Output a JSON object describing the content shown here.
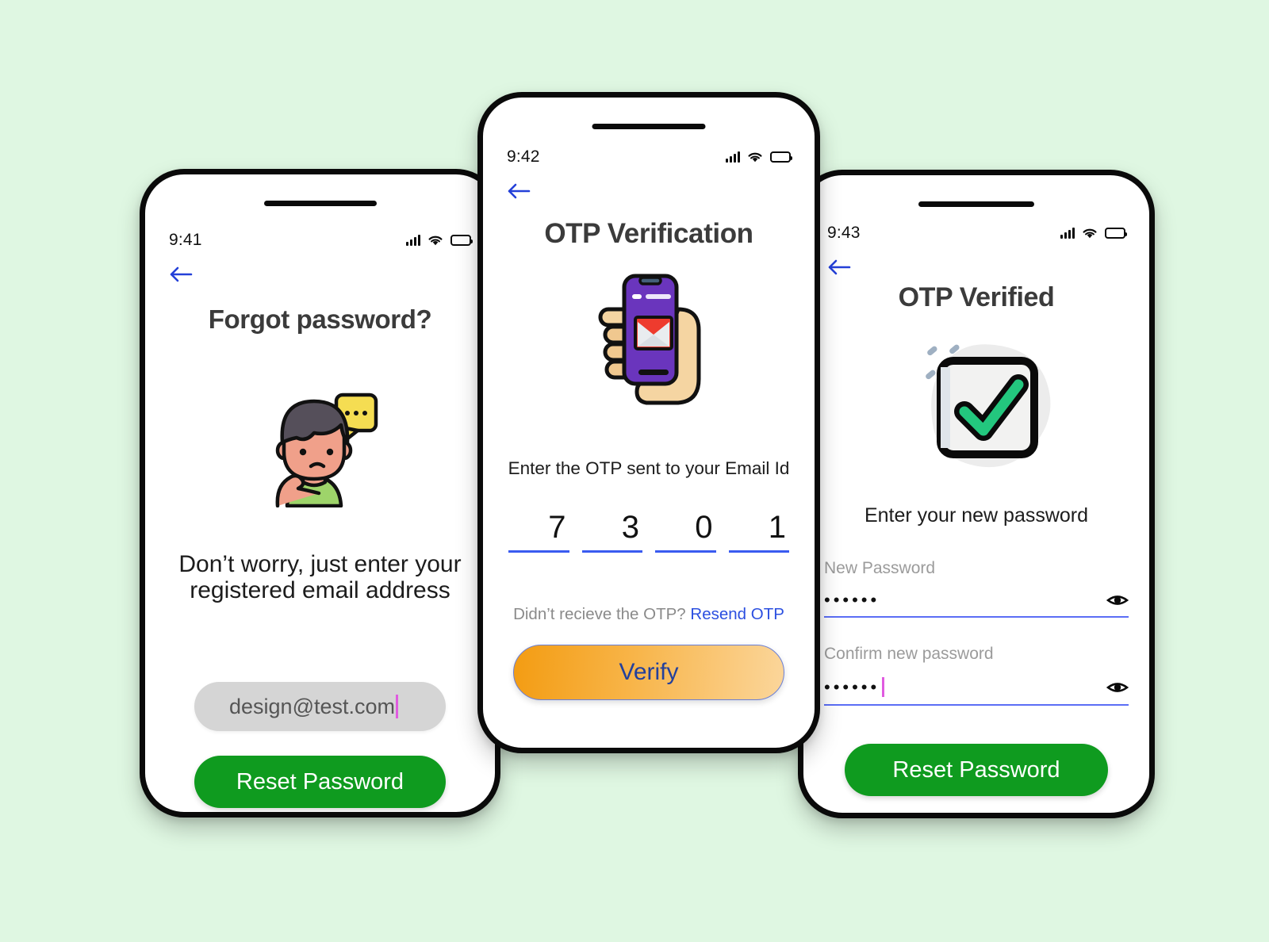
{
  "background_color": "#dff7e2",
  "accent_colors": {
    "primary_green": "#0f9b1f",
    "link_blue": "#2b4fe0",
    "underline_blue": "#3a5bf0",
    "verify_orange": "#f39c12",
    "caret_magenta": "#e05be0",
    "heading_gray": "#3b3b3b"
  },
  "screens": [
    {
      "id": "forgot-password",
      "status": {
        "time": "9:41",
        "signal_icon": "signal-bars-icon",
        "wifi_icon": "wifi-icon",
        "battery_icon": "battery-full-icon"
      },
      "back_icon": "back-arrow-icon",
      "title": "Forgot password?",
      "illustration": "thinking-person-illustration",
      "subtitle": "Don’t worry, just enter your registered email address",
      "email_input": {
        "value": "design@test.com",
        "placeholder": "design@test.com"
      },
      "primary_button": "Reset Password"
    },
    {
      "id": "otp-verification",
      "status": {
        "time": "9:42",
        "signal_icon": "signal-bars-icon",
        "wifi_icon": "wifi-icon",
        "battery_icon": "battery-full-icon"
      },
      "back_icon": "back-arrow-icon",
      "title": "OTP Verification",
      "illustration": "hand-holding-phone-gmail-illustration",
      "subtitle": "Enter the OTP sent to your Email Id",
      "otp_digits": [
        "7",
        "3",
        "0",
        "1"
      ],
      "resend_prompt": "Didn’t recieve the OTP?",
      "resend_link": "Resend OTP",
      "primary_button": "Verify"
    },
    {
      "id": "otp-verified",
      "status": {
        "time": "9:43",
        "signal_icon": "signal-bars-icon",
        "wifi_icon": "wifi-icon",
        "battery_icon": "battery-full-icon"
      },
      "back_icon": "back-arrow-icon",
      "title": "OTP Verified",
      "illustration": "green-checkmark-illustration",
      "subtitle": "Enter your new password",
      "new_password": {
        "label": "New Password",
        "value": "••••••",
        "toggle_icon": "eye-icon"
      },
      "confirm_password": {
        "label": "Confirm new password",
        "value": "••••••",
        "toggle_icon": "eye-icon"
      },
      "primary_button": "Reset Password"
    }
  ]
}
